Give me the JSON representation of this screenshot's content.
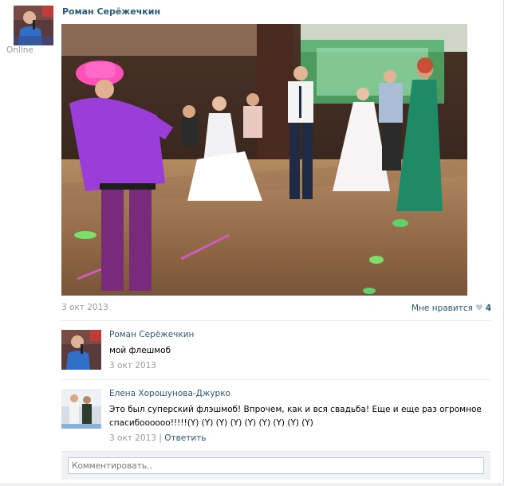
{
  "post": {
    "author": "Роман Серёжечкин",
    "status": "Online",
    "date": "3 окт 2013",
    "like_label": "Мне нравится",
    "like_count": "4"
  },
  "comments": [
    {
      "author": "Роман Серёжечкин",
      "text": "мой флешмоб",
      "date": "3 окт 2013",
      "reply_label": ""
    },
    {
      "author": "Елена Хорошунова-Джурко",
      "text": "Это был суперский флэшмоб! Впрочем, как и вся свадьба! Еще и еще раз огромное спасибоооооо!!!!!(Y) (Y) (Y) (Y) (Y) (Y) (Y) (Y) (Y)",
      "date": "3 окт 2013",
      "reply_label": "Ответить"
    }
  ],
  "reply_box": {
    "placeholder": "Комментировать.."
  },
  "colors": {
    "link": "#2b587a",
    "muted": "#999999",
    "divider": "#e7eaed"
  }
}
